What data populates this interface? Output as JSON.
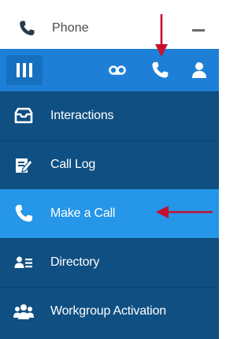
{
  "window": {
    "title": "Phone",
    "minimize_icon": "minimize-icon",
    "title_icon": "phone-icon"
  },
  "toolbar": {
    "menu_icon": "vertical-bars-menu-icon",
    "icons": [
      "voicemail-icon",
      "phone-icon",
      "user-icon"
    ]
  },
  "nav": {
    "items": [
      {
        "label": "Interactions",
        "icon": "inbox-icon",
        "active": false
      },
      {
        "label": "Call Log",
        "icon": "edit-log-icon",
        "active": false
      },
      {
        "label": "Make a Call",
        "icon": "phone-icon",
        "active": true
      },
      {
        "label": "Directory",
        "icon": "contact-list-icon",
        "active": false
      },
      {
        "label": "Workgroup Activation",
        "icon": "group-icon",
        "active": false
      }
    ]
  },
  "colors": {
    "toolbar": "#1e7fd6",
    "nav_bg": "#0f4f82",
    "active_item": "#2596e8",
    "annotation_arrow": "#c8102e"
  }
}
